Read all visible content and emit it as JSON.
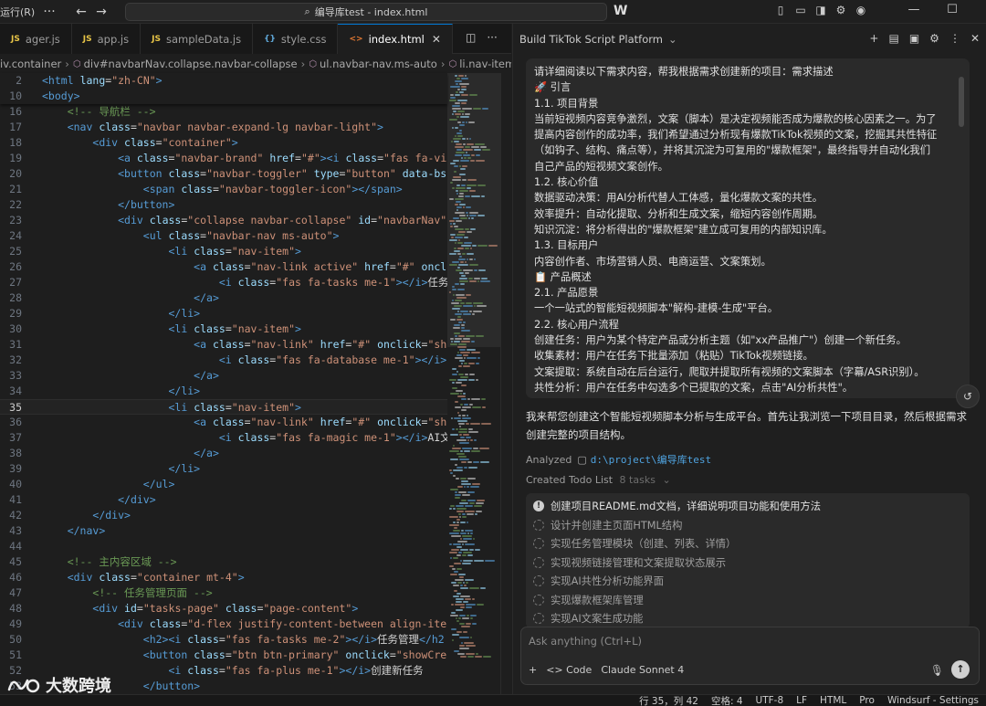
{
  "titlebar": {
    "menu_label": "运行(R)",
    "search_text": "编导库test - index.html",
    "app_logo": "W",
    "window_controls": {
      "minimize": "—",
      "maximize": "☐",
      "close": "✕"
    }
  },
  "tabs": [
    {
      "label": "ager.js",
      "type": "js",
      "badge": "JS"
    },
    {
      "label": "app.js",
      "type": "js",
      "badge": "JS"
    },
    {
      "label": "sampleData.js",
      "type": "js",
      "badge": "JS"
    },
    {
      "label": "style.css",
      "type": "css",
      "badge": "{}"
    },
    {
      "label": "index.html",
      "type": "html",
      "badge": "<>",
      "active": true
    }
  ],
  "breadcrumb": [
    "iv.container",
    "div#navbarNav.collapse.navbar-collapse",
    "ul.navbar-nav.ms-auto",
    "li.nav-item"
  ],
  "editor": {
    "sticky": [
      {
        "n": "2",
        "html": "<span class=\"tg\">&lt;html</span> <span class=\"at\">lang</span>=<span class=\"st\">\"zh-CN\"</span><span class=\"tg\">&gt;</span>"
      },
      {
        "n": "10",
        "html": "<span class=\"tg\">&lt;body&gt;</span>"
      }
    ],
    "lines": [
      {
        "n": "16",
        "html": "    <span class=\"cm\">&lt;!-- 导航栏 --&gt;</span>"
      },
      {
        "n": "17",
        "html": "    <span class=\"tg\">&lt;nav</span> <span class=\"at\">class</span>=<span class=\"st\">\"navbar navbar-expand-lg navbar-light\"</span><span class=\"tg\">&gt;</span>"
      },
      {
        "n": "18",
        "html": "        <span class=\"tg\">&lt;div</span> <span class=\"at\">class</span>=<span class=\"st\">\"container\"</span><span class=\"tg\">&gt;</span>"
      },
      {
        "n": "19",
        "html": "            <span class=\"tg\">&lt;a</span> <span class=\"at\">class</span>=<span class=\"st\">\"navbar-brand\"</span> <span class=\"at\">href</span>=<span class=\"st\">\"#\"</span><span class=\"tg\">&gt;&lt;i</span> <span class=\"at\">class</span>=<span class=\"st\">\"fas fa-vi</span>"
      },
      {
        "n": "20",
        "html": "            <span class=\"tg\">&lt;button</span> <span class=\"at\">class</span>=<span class=\"st\">\"navbar-toggler\"</span> <span class=\"at\">type</span>=<span class=\"st\">\"button\"</span> <span class=\"at\">data-bs</span>"
      },
      {
        "n": "21",
        "html": "                <span class=\"tg\">&lt;span</span> <span class=\"at\">class</span>=<span class=\"st\">\"navbar-toggler-icon\"</span><span class=\"tg\">&gt;&lt;/span&gt;</span>"
      },
      {
        "n": "22",
        "html": "            <span class=\"tg\">&lt;/button&gt;</span>"
      },
      {
        "n": "23",
        "html": "            <span class=\"tg\">&lt;div</span> <span class=\"at\">class</span>=<span class=\"st\">\"collapse navbar-collapse\"</span> <span class=\"at\">id</span>=<span class=\"st\">\"navbarNav\"</span>"
      },
      {
        "n": "24",
        "html": "                <span class=\"tg\">&lt;ul</span> <span class=\"at\">class</span>=<span class=\"st\">\"navbar-nav ms-auto\"</span><span class=\"tg\">&gt;</span>"
      },
      {
        "n": "25",
        "html": "                    <span class=\"tg\">&lt;li</span> <span class=\"at\">class</span>=<span class=\"st\">\"nav-item\"</span><span class=\"tg\">&gt;</span>"
      },
      {
        "n": "26",
        "html": "                        <span class=\"tg\">&lt;a</span> <span class=\"at\">class</span>=<span class=\"st\">\"nav-link active\"</span> <span class=\"at\">href</span>=<span class=\"st\">\"#\"</span> <span class=\"at\">oncl</span>"
      },
      {
        "n": "27",
        "html": "                            <span class=\"tg\">&lt;i</span> <span class=\"at\">class</span>=<span class=\"st\">\"fas fa-tasks me-1\"</span><span class=\"tg\">&gt;&lt;/i&gt;</span><span class=\"tx\">任务</span>"
      },
      {
        "n": "28",
        "html": "                        <span class=\"tg\">&lt;/a&gt;</span>"
      },
      {
        "n": "29",
        "html": "                    <span class=\"tg\">&lt;/li&gt;</span>"
      },
      {
        "n": "30",
        "html": "                    <span class=\"tg\">&lt;li</span> <span class=\"at\">class</span>=<span class=\"st\">\"nav-item\"</span><span class=\"tg\">&gt;</span>"
      },
      {
        "n": "31",
        "html": "                        <span class=\"tg\">&lt;a</span> <span class=\"at\">class</span>=<span class=\"st\">\"nav-link\"</span> <span class=\"at\">href</span>=<span class=\"st\">\"#\"</span> <span class=\"at\">onclick</span>=<span class=\"st\">\"sh</span>"
      },
      {
        "n": "32",
        "html": "                            <span class=\"tg\">&lt;i</span> <span class=\"at\">class</span>=<span class=\"st\">\"fas fa-database me-1\"</span><span class=\"tg\">&gt;&lt;/i&gt;</span>"
      },
      {
        "n": "33",
        "html": "                        <span class=\"tg\">&lt;/a&gt;</span>"
      },
      {
        "n": "34",
        "html": "                    <span class=\"tg\">&lt;/li&gt;</span>"
      },
      {
        "n": "35",
        "html": "                    <span class=\"tg\">&lt;li</span> <span class=\"at\">class</span>=<span class=\"st\">\"nav-item\"</span><span class=\"tg\">&gt;</span>",
        "current": true
      },
      {
        "n": "36",
        "html": "                        <span class=\"tg\">&lt;a</span> <span class=\"at\">class</span>=<span class=\"st\">\"nav-link\"</span> <span class=\"at\">href</span>=<span class=\"st\">\"#\"</span> <span class=\"at\">onclick</span>=<span class=\"st\">\"sh</span>"
      },
      {
        "n": "37",
        "html": "                            <span class=\"tg\">&lt;i</span> <span class=\"at\">class</span>=<span class=\"st\">\"fas fa-magic me-1\"</span><span class=\"tg\">&gt;&lt;/i&gt;</span><span class=\"tx\">AI文</span>"
      },
      {
        "n": "38",
        "html": "                        <span class=\"tg\">&lt;/a&gt;</span>"
      },
      {
        "n": "39",
        "html": "                    <span class=\"tg\">&lt;/li&gt;</span>"
      },
      {
        "n": "40",
        "html": "                <span class=\"tg\">&lt;/ul&gt;</span>"
      },
      {
        "n": "41",
        "html": "            <span class=\"tg\">&lt;/div&gt;</span>"
      },
      {
        "n": "42",
        "html": "        <span class=\"tg\">&lt;/div&gt;</span>"
      },
      {
        "n": "43",
        "html": "    <span class=\"tg\">&lt;/nav&gt;</span>"
      },
      {
        "n": "44",
        "html": ""
      },
      {
        "n": "45",
        "html": "    <span class=\"cm\">&lt;!-- 主内容区域 --&gt;</span>"
      },
      {
        "n": "46",
        "html": "    <span class=\"tg\">&lt;div</span> <span class=\"at\">class</span>=<span class=\"st\">\"container mt-4\"</span><span class=\"tg\">&gt;</span>"
      },
      {
        "n": "47",
        "html": "        <span class=\"cm\">&lt;!-- 任务管理页面 --&gt;</span>"
      },
      {
        "n": "48",
        "html": "        <span class=\"tg\">&lt;div</span> <span class=\"at\">id</span>=<span class=\"st\">\"tasks-page\"</span> <span class=\"at\">class</span>=<span class=\"st\">\"page-content\"</span><span class=\"tg\">&gt;</span>"
      },
      {
        "n": "49",
        "html": "            <span class=\"tg\">&lt;div</span> <span class=\"at\">class</span>=<span class=\"st\">\"d-flex justify-content-between align-ite</span>"
      },
      {
        "n": "50",
        "html": "                <span class=\"tg\">&lt;h2&gt;&lt;i</span> <span class=\"at\">class</span>=<span class=\"st\">\"fas fa-tasks me-2\"</span><span class=\"tg\">&gt;&lt;/i&gt;</span><span class=\"tx\">任务管理</span><span class=\"tg\">&lt;/h2</span>"
      },
      {
        "n": "51",
        "html": "                <span class=\"tg\">&lt;button</span> <span class=\"at\">class</span>=<span class=\"st\">\"btn btn-primary\"</span> <span class=\"at\">onclick</span>=<span class=\"st\">\"showCre</span>"
      },
      {
        "n": "52",
        "html": "                    <span class=\"tg\">&lt;i</span> <span class=\"at\">class</span>=<span class=\"st\">\"fas fa-plus me-1\"</span><span class=\"tg\">&gt;&lt;/i&gt;</span><span class=\"tx\">创建新任务</span>"
      },
      {
        "n": "53",
        "html": "                <span class=\"tg\">&lt;/button&gt;</span>"
      }
    ]
  },
  "panel": {
    "title": "Build TikTok Script Platform",
    "prompt_lines": [
      "请详细阅读以下需求内容，帮我根据需求创建新的项目：需求描述",
      "🚀 引言",
      "1.1. 项目背景",
      "当前短视频内容竞争激烈，文案（脚本）是决定视频能否成为爆款的核心因素之一。为了",
      "提高内容创作的成功率，我们希望通过分析现有爆款TikTok视频的文案，挖掘其共性特征",
      "（如钩子、结构、痛点等），并将其沉淀为可复用的\"爆款框架\"，最终指导并自动化我们",
      "自己产品的短视频文案创作。",
      "1.2. 核心价值",
      "数据驱动决策：用AI分析代替人工体感，量化爆款文案的共性。",
      "效率提升：自动化提取、分析和生成文案，缩短内容创作周期。",
      "知识沉淀：将分析得出的\"爆款框架\"建立成可复用的内部知识库。",
      "1.3. 目标用户",
      "内容创作者、市场营销人员、电商运营、文案策划。",
      "📋 产品概述",
      "2.1. 产品愿景",
      "一个一站式的智能短视频脚本\"解构-建模-生成\"平台。",
      "2.2. 核心用户流程",
      "创建任务：用户为某个特定产品或分析主题（如\"xx产品推广\"）创建一个新任务。",
      "收集素材：用户在任务下批量添加（粘贴）TikTok视频链接。",
      "文案提取：系统自动在后台运行，爬取并提取所有视频的文案脚本（字幕/ASR识别）。",
      "共性分析：用户在任务中勾选多个已提取的文案，点击\"AI分析共性\"。"
    ],
    "reply_text": "我来帮您创建这个智能短视频脚本分析与生成平台。首先让我浏览一下项目目录，然后根据需求创建完整的项目结构。",
    "analyzed_label": "Analyzed",
    "analyzed_path": "d:\\project\\编导库test",
    "todo_label": "Created Todo List",
    "todo_count": "8 tasks",
    "todos": [
      {
        "text": "创建项目README.md文档，详细说明项目功能和使用方法",
        "active": true
      },
      {
        "text": "设计并创建主页面HTML结构",
        "active": false
      },
      {
        "text": "实现任务管理模块（创建、列表、详情）",
        "active": false
      },
      {
        "text": "实现视频链接管理和文案提取状态展示",
        "active": false
      },
      {
        "text": "实现AI共性分析功能界面",
        "active": false
      },
      {
        "text": "实现爆款框架库管理",
        "active": false
      },
      {
        "text": "实现AI文案生成功能",
        "active": false
      }
    ],
    "input_placeholder": "Ask anything (Ctrl+L)",
    "input_add": "+",
    "input_mode": "<> Code",
    "input_model": "Claude Sonnet 4"
  },
  "statusbar": {
    "position": "行 35，列 42",
    "spaces": "空格: 4",
    "encoding": "UTF-8",
    "eol": "LF",
    "language": "HTML",
    "plan": "Pro",
    "settings": "Windsurf - Settings"
  },
  "watermark": {
    "text": "大数跨境"
  },
  "colors": {
    "accent": "#0078d4",
    "tag": "#569cd6",
    "attr": "#9cdcfe",
    "string": "#ce9178",
    "comment": "#6a9955"
  }
}
